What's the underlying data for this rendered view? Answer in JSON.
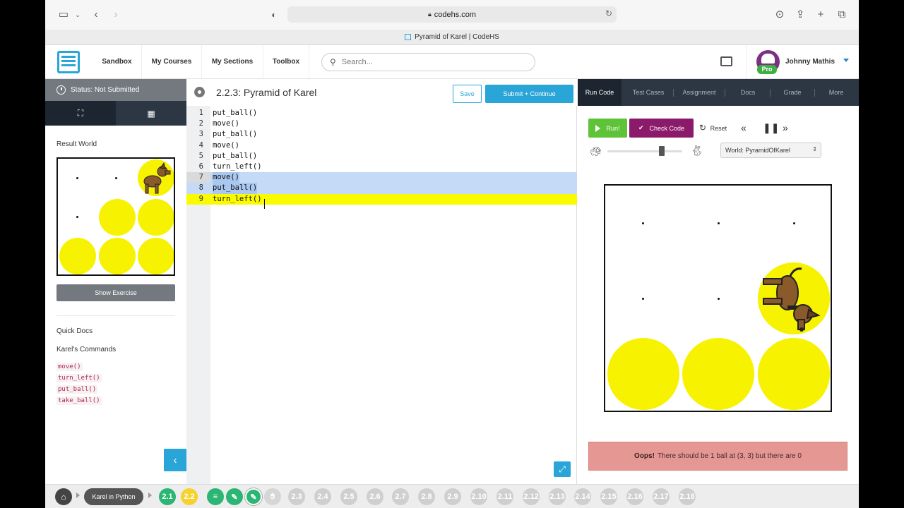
{
  "browser": {
    "url": "codehs.com",
    "tab_title": "Pyramid of Karel | CodeHS"
  },
  "header": {
    "nav": [
      "Sandbox",
      "My Courses",
      "My Sections",
      "Toolbox"
    ],
    "search_placeholder": "Search...",
    "user_name": "Johnny Mathis",
    "badge": "Pro"
  },
  "sidebar": {
    "status": "Status: Not Submitted",
    "result_world_label": "Result World",
    "show_exercise": "Show Exercise",
    "quick_docs": "Quick Docs",
    "commands_title": "Karel's Commands",
    "commands": [
      "move()",
      "turn_left()",
      "put_ball()",
      "take_ball()"
    ]
  },
  "editor": {
    "title": "2.2.3: Pyramid of Karel",
    "save": "Save",
    "submit": "Submit + Continue",
    "lines": [
      "put_ball()",
      "move()",
      "put_ball()",
      "move()",
      "put_ball()",
      "turn_left()",
      "move()",
      "put_ball()",
      "turn_left()"
    ]
  },
  "right": {
    "tabs": [
      "Run Code",
      "Test Cases",
      "Assignment",
      "Docs",
      "Grade",
      "More"
    ],
    "run": "Run!",
    "check": "Check Code",
    "reset": "Reset",
    "world_select": "World: PyramidOfKarel",
    "error_strong": "Oops!",
    "error_text": "There should be 1 ball at (3, 3) but there are 0"
  },
  "bottom": {
    "course": "Karel in Python",
    "lessons": [
      "2.1",
      "2.2",
      "2.3",
      "2.4",
      "2.5",
      "2.6",
      "2.7",
      "2.8",
      "2.9",
      "2.10",
      "2.11",
      "2.12",
      "2.13",
      "2.14",
      "2.15",
      "2.16",
      "2.17",
      "2.18"
    ]
  },
  "colors": {
    "accent": "#2aa5d8",
    "ball": "#f7f200",
    "run": "#5fc339",
    "check": "#8c1a6a",
    "error": "#e59794"
  }
}
